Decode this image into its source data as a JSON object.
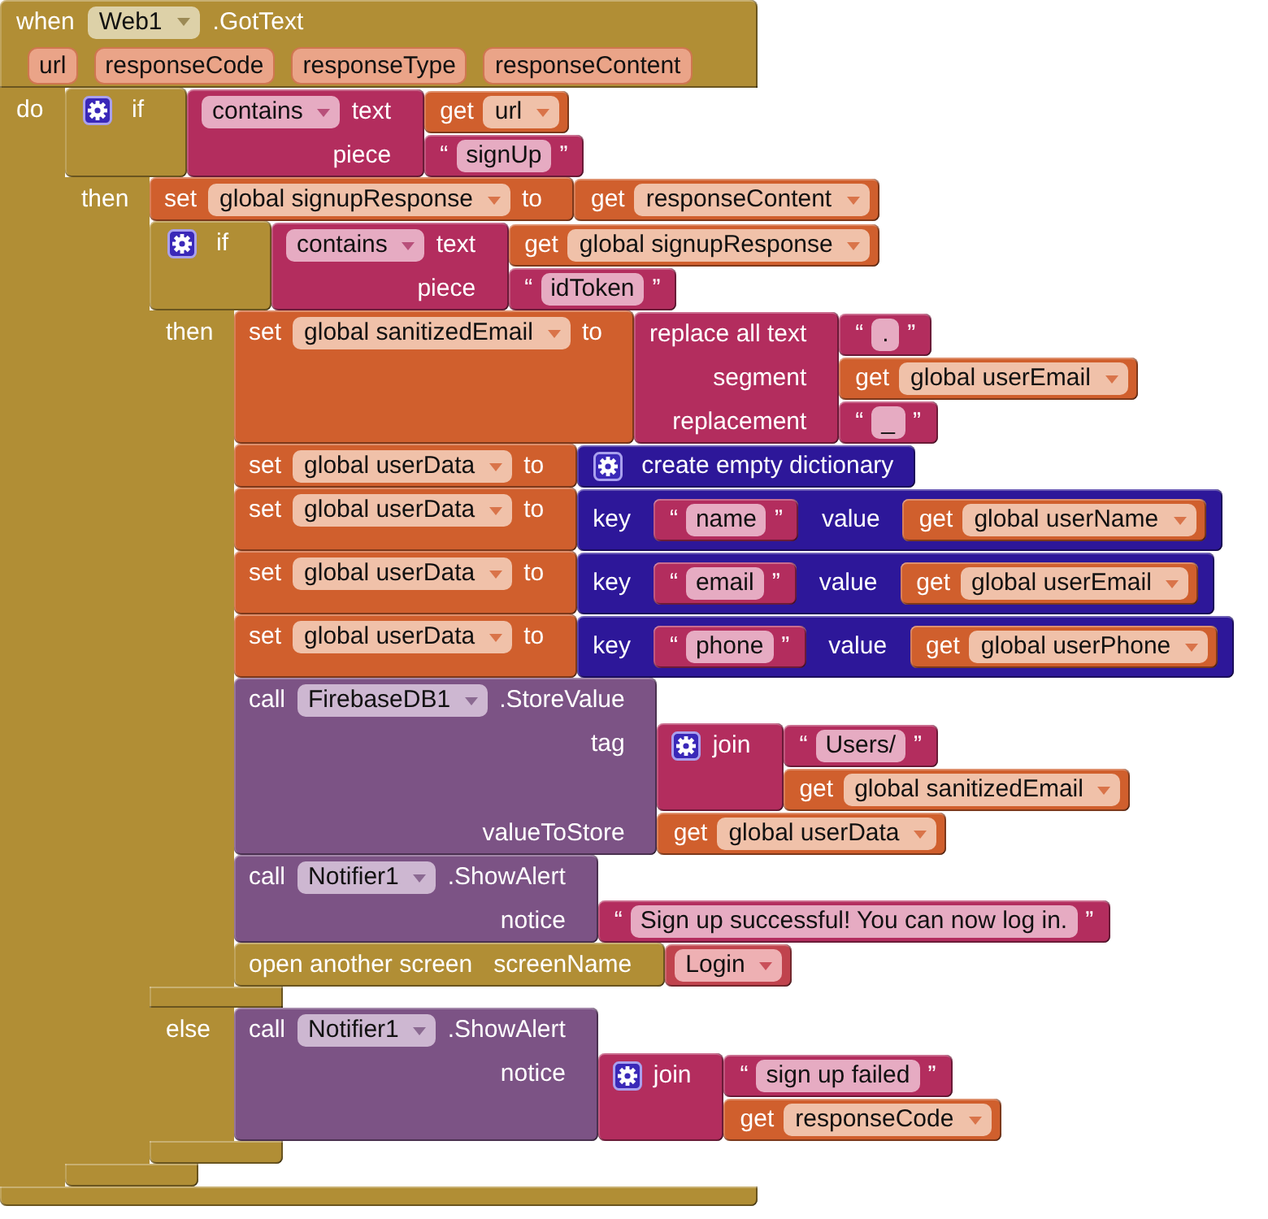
{
  "event": {
    "keyword": "when",
    "component": "Web1",
    "event_name": ".GotText",
    "params": [
      "url",
      "responseCode",
      "responseType",
      "responseContent"
    ],
    "do_label": "do",
    "body": [
      {
        "kind": "if",
        "mutator": true,
        "keyword": "if",
        "condition": {
          "kind": "contains",
          "operation": "contains",
          "args": [
            {
              "label": "text",
              "value": {
                "kind": "get",
                "keyword": "get",
                "variable": "url"
              }
            },
            {
              "label": "piece",
              "value": {
                "kind": "text",
                "quotes": [
                  "“",
                  "”"
                ],
                "value": "signUp"
              }
            }
          ]
        },
        "branches": [
          {
            "label": "then",
            "body": [
              {
                "kind": "set",
                "keyword": "set",
                "variable": "global signupResponse",
                "to_label": "to",
                "value": {
                  "kind": "get",
                  "keyword": "get",
                  "variable": "responseContent"
                }
              },
              {
                "kind": "if",
                "mutator": true,
                "keyword": "if",
                "condition": {
                  "kind": "contains",
                  "operation": "contains",
                  "args": [
                    {
                      "label": "text",
                      "value": {
                        "kind": "get",
                        "keyword": "get",
                        "variable": "global signupResponse"
                      }
                    },
                    {
                      "label": "piece",
                      "value": {
                        "kind": "text",
                        "quotes": [
                          "“",
                          "”"
                        ],
                        "value": "idToken"
                      }
                    }
                  ]
                },
                "branches": [
                  {
                    "label": "then",
                    "body": [
                      {
                        "kind": "set",
                        "keyword": "set",
                        "variable": "global sanitizedEmail",
                        "to_label": "to",
                        "value": {
                          "kind": "replace_all",
                          "args": [
                            {
                              "label": "replace all text",
                              "value": {
                                "kind": "text",
                                "quotes": [
                                  "“",
                                  "”"
                                ],
                                "value": "."
                              }
                            },
                            {
                              "label": "segment",
                              "value": {
                                "kind": "get",
                                "keyword": "get",
                                "variable": "global userEmail"
                              }
                            },
                            {
                              "label": "replacement",
                              "value": {
                                "kind": "text",
                                "quotes": [
                                  "“",
                                  "”"
                                ],
                                "value": "_"
                              }
                            }
                          ]
                        }
                      },
                      {
                        "kind": "set",
                        "keyword": "set",
                        "variable": "global userData",
                        "to_label": "to",
                        "value": {
                          "kind": "create_dict",
                          "mutator": true,
                          "label": "create empty dictionary"
                        }
                      },
                      {
                        "kind": "set",
                        "keyword": "set",
                        "variable": "global userData",
                        "to_label": "to",
                        "value": {
                          "kind": "pair",
                          "key_label": "key",
                          "key": {
                            "kind": "text",
                            "quotes": [
                              "“",
                              "”"
                            ],
                            "value": "name"
                          },
                          "value_label": "value",
                          "value": {
                            "kind": "get",
                            "keyword": "get",
                            "variable": "global userName"
                          }
                        }
                      },
                      {
                        "kind": "set",
                        "keyword": "set",
                        "variable": "global userData",
                        "to_label": "to",
                        "value": {
                          "kind": "pair",
                          "key_label": "key",
                          "key": {
                            "kind": "text",
                            "quotes": [
                              "“",
                              "”"
                            ],
                            "value": "email"
                          },
                          "value_label": "value",
                          "value": {
                            "kind": "get",
                            "keyword": "get",
                            "variable": "global userEmail"
                          }
                        }
                      },
                      {
                        "kind": "set",
                        "keyword": "set",
                        "variable": "global userData",
                        "to_label": "to",
                        "value": {
                          "kind": "pair",
                          "key_label": "key",
                          "key": {
                            "kind": "text",
                            "quotes": [
                              "“",
                              "”"
                            ],
                            "value": "phone"
                          },
                          "value_label": "value",
                          "value": {
                            "kind": "get",
                            "keyword": "get",
                            "variable": "global userPhone"
                          }
                        }
                      },
                      {
                        "kind": "call",
                        "keyword": "call",
                        "component": "FirebaseDB1",
                        "method": ".StoreValue",
                        "args": [
                          {
                            "label": "tag",
                            "value": {
                              "kind": "join",
                              "mutator": true,
                              "label": "join",
                              "items": [
                                {
                                  "kind": "text",
                                  "quotes": [
                                    "“",
                                    "”"
                                  ],
                                  "value": "Users/"
                                },
                                {
                                  "kind": "get",
                                  "keyword": "get",
                                  "variable": "global sanitizedEmail"
                                }
                              ]
                            }
                          },
                          {
                            "label": "valueToStore",
                            "value": {
                              "kind": "get",
                              "keyword": "get",
                              "variable": "global userData"
                            }
                          }
                        ]
                      },
                      {
                        "kind": "call",
                        "keyword": "call",
                        "component": "Notifier1",
                        "method": ".ShowAlert",
                        "args": [
                          {
                            "label": "notice",
                            "value": {
                              "kind": "text",
                              "quotes": [
                                "“",
                                "”"
                              ],
                              "value": "Sign up successful! You can now log in."
                            }
                          }
                        ]
                      },
                      {
                        "kind": "open_screen",
                        "label": "open another screen",
                        "args": [
                          {
                            "label": "screenName",
                            "value": {
                              "kind": "screen",
                              "value": "Login"
                            }
                          }
                        ]
                      }
                    ]
                  },
                  {
                    "label": "else",
                    "body": [
                      {
                        "kind": "call",
                        "keyword": "call",
                        "component": "Notifier1",
                        "method": ".ShowAlert",
                        "args": [
                          {
                            "label": "notice",
                            "value": {
                              "kind": "join",
                              "mutator": true,
                              "label": "join",
                              "items": [
                                {
                                  "kind": "text",
                                  "quotes": [
                                    "“",
                                    "”"
                                  ],
                                  "value": "sign up failed"
                                },
                                {
                                  "kind": "get",
                                  "keyword": "get",
                                  "variable": "responseCode"
                                }
                              ]
                            }
                          }
                        ]
                      }
                    ]
                  }
                ]
              }
            ]
          }
        ]
      }
    ]
  }
}
